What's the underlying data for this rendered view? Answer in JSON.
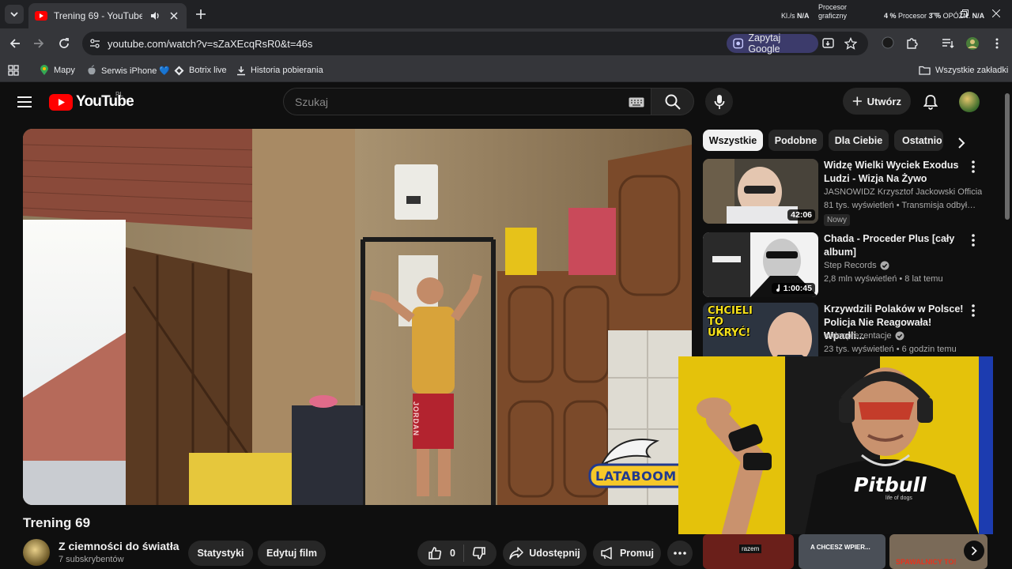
{
  "browser": {
    "tab_title": "Trening 69 - YouTube",
    "url": "youtube.com/watch?v=sZaXEcqRsR0&t=46s",
    "ask_google": "Zapytaj Google",
    "ext_label": "ext",
    "perf": {
      "kl_label": "Kl./s",
      "kl_value": "N/A",
      "gpu_label": "Procesor graficzny",
      "cpu_value": "4 %",
      "cpu_label": "Procesor",
      "cpu2_value": "3 %",
      "latency_label": "OPÓŹN.",
      "latency_value": "N/A"
    },
    "bookmarks": [
      "Mapy",
      "Serwis iPhone 💙",
      "Botrix live",
      "Historia pobierania"
    ],
    "all_bookmarks": "Wszystkie zakładki"
  },
  "youtube": {
    "logo_text": "YouTube",
    "logo_region": "PL",
    "search_placeholder": "Szukaj",
    "create_label": "Utwórz",
    "video": {
      "title": "Trening 69",
      "channel": "Z ciemności do światła",
      "subscribers": "7 subskrybentów",
      "stats_label": "Statystyki",
      "edit_label": "Edytuj film",
      "likes": "0",
      "share_label": "Udostępnij",
      "promote_label": "Promuj"
    },
    "chips": [
      "Wszystkie",
      "Podobne",
      "Dla Ciebie",
      "Ostatnio"
    ],
    "recommendations": [
      {
        "title": "Widzę Wielki Wyciek Exodus Ludzi - Wizja Na Żywo",
        "channel": "JASNOWIDZ Krzysztof Jackowski Official",
        "meta": "81 tys. wyświetleń • Transmisja odbyła się",
        "badge": "Nowy",
        "duration": "42:06"
      },
      {
        "title": "Chada - Proceder Plus [cały album]",
        "channel": "Step Records",
        "meta": "2,8 mln wyświetleń • 8 lat temu",
        "duration": "1:00:45"
      },
      {
        "title": "Krzywdzili Polaków w Polsce! Policja Nie Reagowała! Wpadli...",
        "channel": "wideoprezentacje",
        "meta": "23 tys. wyświetleń • 6 godzin temu",
        "thumb_text": "CHCIELI TO UKRYĆ!"
      }
    ],
    "overlay": {
      "sticker_text": "LATABOOM",
      "shirt_text": "Pitbull",
      "shirt_sub": "life of dogs",
      "jersey_text": "JORDAN",
      "strip_1": "razem",
      "strip_2": "A CHCESZ WPIER...",
      "strip_3": "SPAWALNICY TO!"
    },
    "colors": {
      "brand_red": "#ff0000",
      "background": "#0f0f0f",
      "chip": "#272727",
      "facecam_yellow": "#e4c20b"
    }
  }
}
